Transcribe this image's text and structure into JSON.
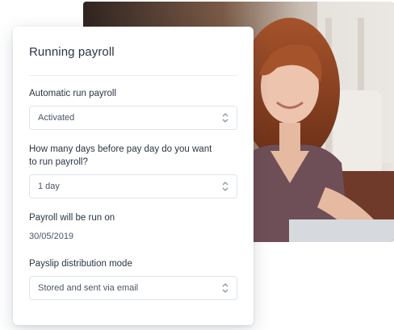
{
  "card": {
    "title": "Running payroll",
    "fields": {
      "automatic_run": {
        "label": "Automatic run payroll",
        "value": "Activated"
      },
      "days_before": {
        "label": "How many days before pay day do you want to run payroll?",
        "value": "1 day"
      },
      "run_date": {
        "label": "Payroll will be run on",
        "value": "30/05/2019"
      },
      "payslip_mode": {
        "label": "Payslip distribution mode",
        "value": "Stored and sent via email"
      }
    }
  },
  "icons": {
    "select_chevron": "chevron-up-down-icon"
  },
  "colors": {
    "text_primary": "#2b3544",
    "text_secondary": "#4a5566",
    "border": "#dfe4ea"
  }
}
